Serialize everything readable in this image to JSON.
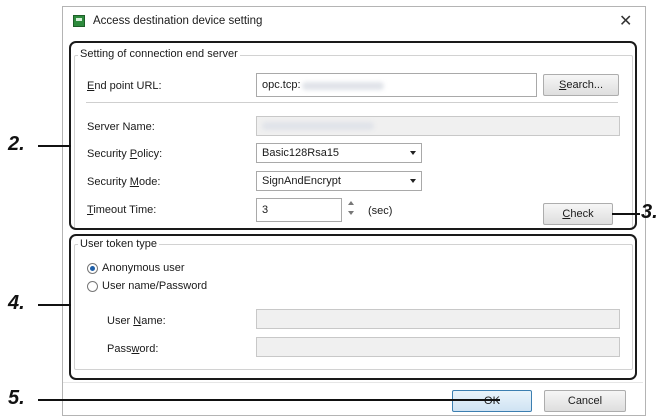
{
  "dialog": {
    "title": "Access destination device setting",
    "close_glyph": "✕",
    "icon": "app-icon"
  },
  "connection": {
    "group_label": "Setting of connection end server",
    "endpoint": {
      "label_u": "E",
      "label_rest": "nd point URL:",
      "value": "opc.tcp:"
    },
    "search_button": {
      "label_u": "S",
      "label_rest": "earch..."
    },
    "server_name": {
      "label": "Server Name:"
    },
    "security_policy": {
      "label_pre": "Security ",
      "label_u": "P",
      "label_rest": "olicy:",
      "value": "Basic128Rsa15"
    },
    "security_mode": {
      "label_pre": "Security ",
      "label_u": "M",
      "label_rest": "ode:",
      "value": "SignAndEncrypt"
    },
    "timeout": {
      "label_u": "T",
      "label_rest": "imeout Time:",
      "value": "3",
      "unit": "(sec)"
    },
    "check_button": {
      "label_u": "C",
      "label_rest": "heck"
    }
  },
  "token": {
    "group_label": "User token type",
    "anonymous": {
      "label": "Anonymous user",
      "selected": true
    },
    "password_option": {
      "label": "User name/Password",
      "selected": false
    },
    "user_name": {
      "label_pre": "User ",
      "label_u": "N",
      "label_rest": "ame:"
    },
    "password": {
      "label_pre": "Pass",
      "label_u": "w",
      "label_rest": "ord:"
    }
  },
  "footer": {
    "ok_label": "OK",
    "cancel_label": "Cancel"
  },
  "callouts": {
    "c2": "2.",
    "c3": "3.",
    "c4": "4.",
    "c5": "5."
  }
}
